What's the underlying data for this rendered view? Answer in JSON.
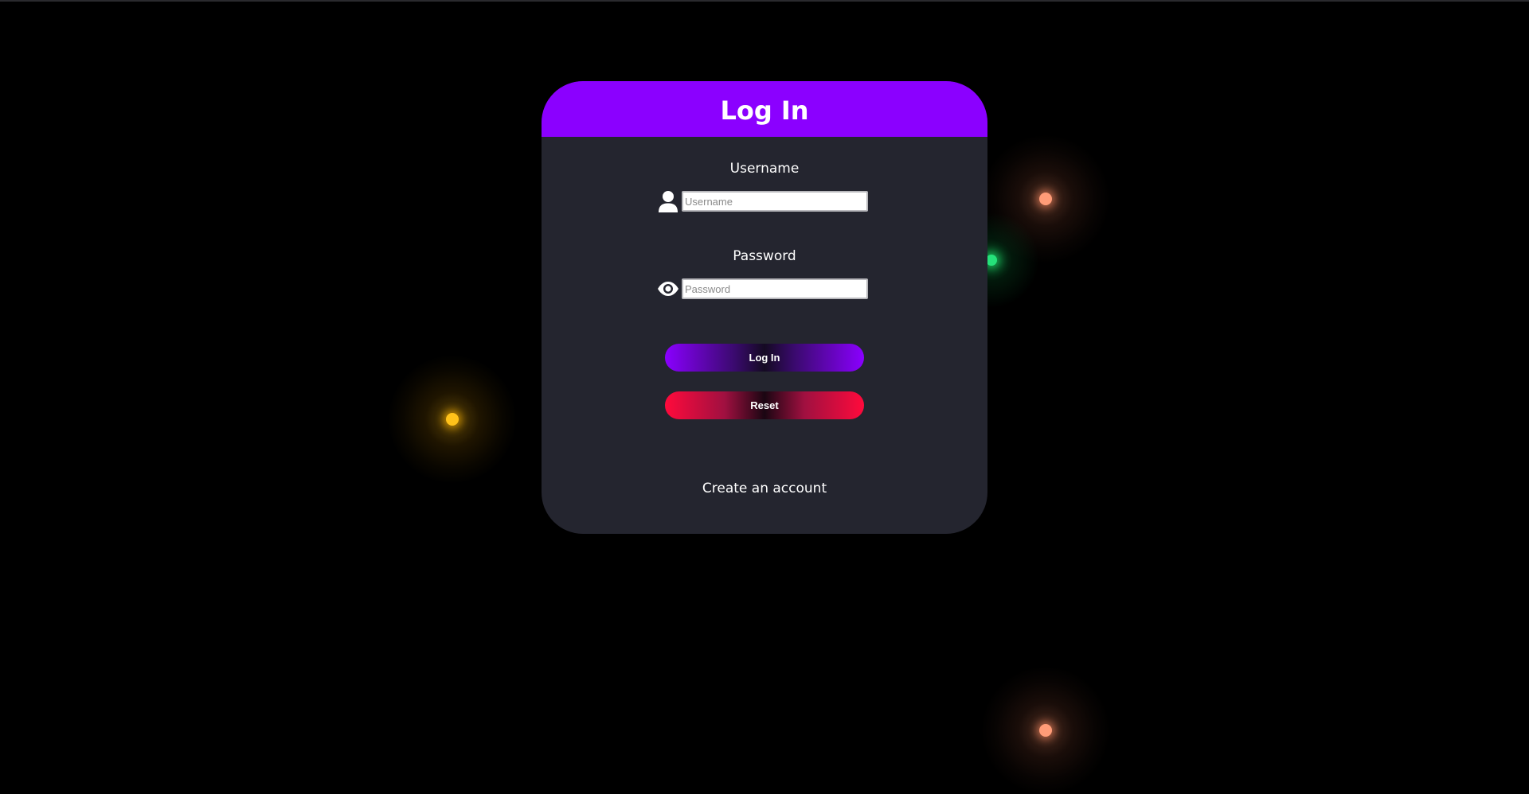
{
  "card": {
    "title": "Log In"
  },
  "username": {
    "label": "Username",
    "icon": "user-icon",
    "placeholder": "Username",
    "value": ""
  },
  "password": {
    "label": "Password",
    "icon": "eye-icon",
    "placeholder": "Password",
    "value": ""
  },
  "buttons": {
    "login_label": "Log In",
    "reset_label": "Reset"
  },
  "links": {
    "create_account": "Create an account"
  },
  "colors": {
    "header": "#8b00ff",
    "card_bg": "#24252f",
    "page_bg": "#000000",
    "login_accent": "#8a00ff",
    "reset_accent": "#ff0a3c"
  }
}
